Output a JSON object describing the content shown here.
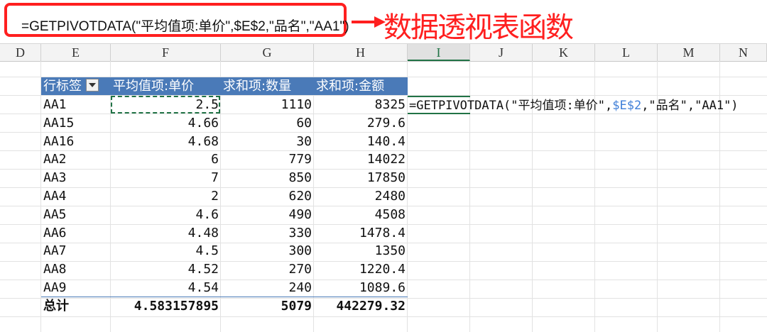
{
  "formula_bar": {
    "formula": "=GETPIVOTDATA(\"平均值项:单价\",$E$2,\"品名\",\"AA1\")",
    "annotation": "数据透视表函数",
    "annotation_color": "#ff1f1f"
  },
  "columns": [
    "D",
    "E",
    "F",
    "G",
    "H",
    "I",
    "J",
    "K",
    "L",
    "M",
    "N"
  ],
  "active_column": "I",
  "pivot": {
    "headers": {
      "row_label": "行标签",
      "avg_price": "平均值项:单价",
      "sum_qty": "求和项:数量",
      "sum_amount": "求和项:金额"
    },
    "header_color": "#4a7ab8",
    "rows": [
      {
        "name": "AA1",
        "avg": "2.5",
        "qty": "1110",
        "amount": "8325"
      },
      {
        "name": "AA15",
        "avg": "4.66",
        "qty": "60",
        "amount": "279.6"
      },
      {
        "name": "AA16",
        "avg": "4.68",
        "qty": "30",
        "amount": "140.4"
      },
      {
        "name": "AA2",
        "avg": "6",
        "qty": "779",
        "amount": "14022"
      },
      {
        "name": "AA3",
        "avg": "7",
        "qty": "850",
        "amount": "17850"
      },
      {
        "name": "AA4",
        "avg": "2",
        "qty": "620",
        "amount": "2480"
      },
      {
        "name": "AA5",
        "avg": "4.6",
        "qty": "490",
        "amount": "4508"
      },
      {
        "name": "AA6",
        "avg": "4.48",
        "qty": "330",
        "amount": "1478.4"
      },
      {
        "name": "AA7",
        "avg": "4.5",
        "qty": "300",
        "amount": "1350"
      },
      {
        "name": "AA8",
        "avg": "4.52",
        "qty": "270",
        "amount": "1220.4"
      },
      {
        "name": "AA9",
        "avg": "4.54",
        "qty": "240",
        "amount": "1089.6"
      }
    ],
    "total": {
      "name": "总计",
      "avg": "4.583157895",
      "qty": "5079",
      "amount": "442279.32"
    }
  },
  "formula_cell": {
    "prefix": "=GETPIVOTDATA(\"平均值项:单价\",",
    "ref": "$E$2",
    "suffix": ",\"品名\",\"AA1\")",
    "ref_color": "#3f7fd8"
  }
}
